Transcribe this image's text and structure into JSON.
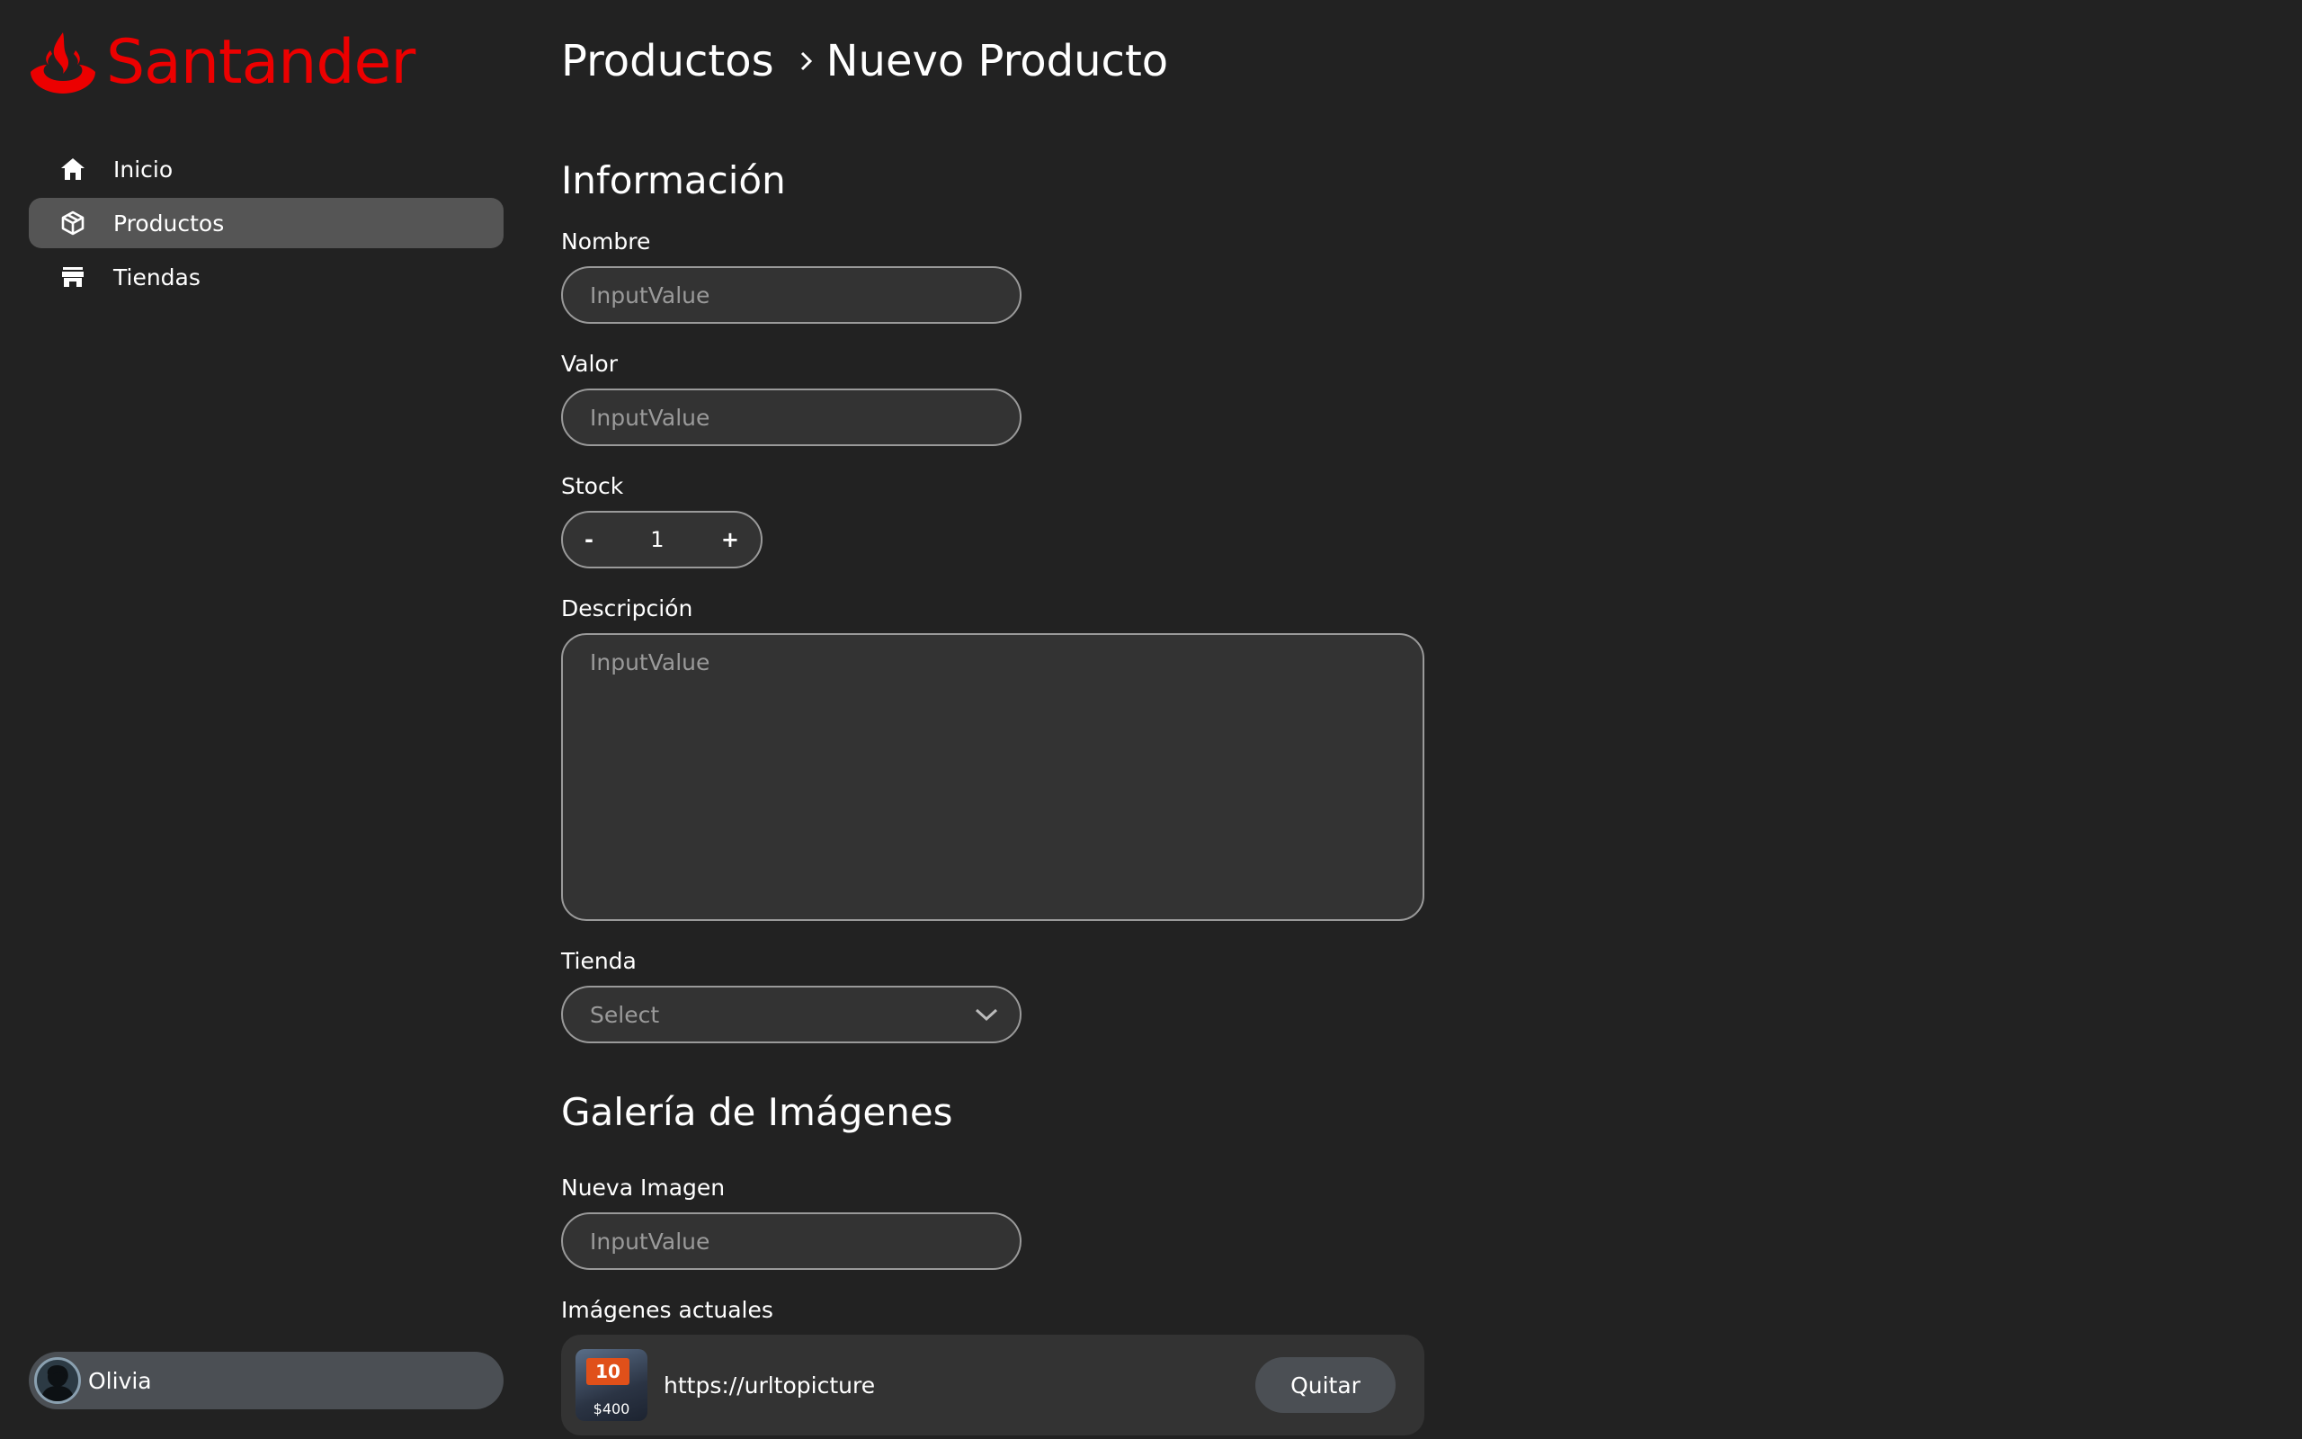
{
  "brand": {
    "name": "Santander",
    "color": "#ec0000"
  },
  "sidebar": {
    "items": [
      {
        "label": "Inicio",
        "icon": "home-icon",
        "active": false
      },
      {
        "label": "Productos",
        "icon": "package-icon",
        "active": true
      },
      {
        "label": "Tiendas",
        "icon": "store-icon",
        "active": false
      }
    ],
    "user": {
      "name": "Olivia"
    }
  },
  "breadcrumb": {
    "parent": "Productos",
    "current": "Nuevo Producto"
  },
  "info": {
    "title": "Información",
    "nombre": {
      "label": "Nombre",
      "placeholder": "InputValue"
    },
    "valor": {
      "label": "Valor",
      "placeholder": "InputValue"
    },
    "stock": {
      "label": "Stock",
      "minus": "-",
      "value": "1",
      "plus": "+"
    },
    "descripcion": {
      "label": "Descripción",
      "placeholder": "InputValue"
    },
    "tienda": {
      "label": "Tienda",
      "placeholder": "Select"
    }
  },
  "gallery": {
    "title": "Galería de Imágenes",
    "new_image": {
      "label": "Nueva Imagen",
      "placeholder": "InputValue"
    },
    "current_label": "Imágenes actuales",
    "images": [
      {
        "url": "https://urltopicture",
        "thumb_badge": "10",
        "thumb_price": "$400",
        "remove_label": "Quitar"
      }
    ]
  }
}
